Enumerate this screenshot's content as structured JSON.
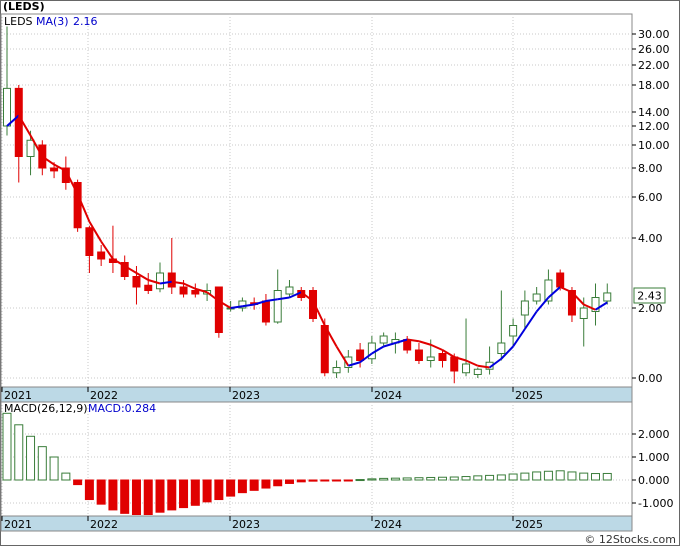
{
  "header": {
    "symbol_title": "(LEDS)",
    "ticker": "LEDS",
    "ma_label": "MA(3)",
    "ma_value": "2.16",
    "macd_label": "MACD(26,12,9)",
    "macd_value_label": "MACD:0.284",
    "last_price_badge": "2.43",
    "copyright": "© 12Stocks.com"
  },
  "colors": {
    "up_candle": "#3a7d3a",
    "down_candle": "#e00000",
    "ma_down": "#e00000",
    "ma_up": "#0000dd",
    "axis_band": "#bcd9e6",
    "grid": "#c8c8c8",
    "macd_pos": "#3a7d3a",
    "macd_neg": "#e00000"
  },
  "chart_data": [
    {
      "type": "candlestick",
      "title": "(LEDS)",
      "y_scale": "log",
      "y_ticks": [
        0.0,
        2.0,
        4.0,
        6.0,
        8.0,
        10.0,
        12.0,
        14.0,
        18.0,
        22.0,
        26.0,
        30.0
      ],
      "y_tick_labels": [
        "0.00",
        "2.00",
        "4.00",
        "6.00",
        "8.00",
        "10.00",
        "12.00",
        "14.00",
        "18.00",
        "22.00",
        "26.00",
        "30.00"
      ],
      "x_labels": [
        "2021",
        "2022",
        "2023",
        "2024",
        "2025"
      ],
      "grid": true,
      "candles": [
        {
          "o": 12.0,
          "h": 32.0,
          "l": 11.0,
          "c": 17.5
        },
        {
          "o": 17.5,
          "h": 18.0,
          "l": 7.0,
          "c": 9.0
        },
        {
          "o": 9.0,
          "h": 11.5,
          "l": 7.5,
          "c": 10.5
        },
        {
          "o": 10.0,
          "h": 10.5,
          "l": 7.5,
          "c": 8.0
        },
        {
          "o": 8.0,
          "h": 8.5,
          "l": 7.3,
          "c": 7.8
        },
        {
          "o": 8.0,
          "h": 9.0,
          "l": 6.5,
          "c": 7.0
        },
        {
          "o": 7.0,
          "h": 7.2,
          "l": 4.3,
          "c": 4.5
        },
        {
          "o": 4.5,
          "h": 4.6,
          "l": 3.0,
          "c": 3.5
        },
        {
          "o": 3.6,
          "h": 3.8,
          "l": 3.2,
          "c": 3.4
        },
        {
          "o": 3.4,
          "h": 4.6,
          "l": 3.0,
          "c": 3.3
        },
        {
          "o": 3.3,
          "h": 3.5,
          "l": 2.8,
          "c": 2.9
        },
        {
          "o": 2.9,
          "h": 3.2,
          "l": 2.1,
          "c": 2.6
        },
        {
          "o": 2.65,
          "h": 3.0,
          "l": 2.4,
          "c": 2.5
        },
        {
          "o": 2.55,
          "h": 3.3,
          "l": 2.45,
          "c": 3.0
        },
        {
          "o": 3.0,
          "h": 4.0,
          "l": 2.4,
          "c": 2.6
        },
        {
          "o": 2.6,
          "h": 2.8,
          "l": 2.3,
          "c": 2.4
        },
        {
          "o": 2.5,
          "h": 2.7,
          "l": 2.3,
          "c": 2.4
        },
        {
          "o": 2.4,
          "h": 2.7,
          "l": 2.2,
          "c": 2.5
        },
        {
          "o": 2.6,
          "h": 2.6,
          "l": 1.15,
          "c": 1.3
        },
        {
          "o": 2.0,
          "h": 2.2,
          "l": 1.9,
          "c": 2.0
        },
        {
          "o": 2.0,
          "h": 2.3,
          "l": 1.9,
          "c": 2.2
        },
        {
          "o": 2.15,
          "h": 2.3,
          "l": 1.95,
          "c": 2.1
        },
        {
          "o": 2.2,
          "h": 2.4,
          "l": 1.5,
          "c": 1.6
        },
        {
          "o": 1.6,
          "h": 3.1,
          "l": 1.55,
          "c": 2.5
        },
        {
          "o": 2.4,
          "h": 2.8,
          "l": 2.3,
          "c": 2.6
        },
        {
          "o": 2.5,
          "h": 2.6,
          "l": 2.2,
          "c": 2.3
        },
        {
          "o": 2.5,
          "h": 2.6,
          "l": 1.6,
          "c": 1.7
        },
        {
          "o": 1.5,
          "h": 1.7,
          "l": 0.05,
          "c": 0.15
        },
        {
          "o": 0.15,
          "h": 0.5,
          "l": 0.0,
          "c": 0.3
        },
        {
          "o": 0.3,
          "h": 0.8,
          "l": 0.15,
          "c": 0.6
        },
        {
          "o": 0.8,
          "h": 1.0,
          "l": 0.3,
          "c": 0.5
        },
        {
          "o": 0.55,
          "h": 1.2,
          "l": 0.4,
          "c": 1.0
        },
        {
          "o": 1.0,
          "h": 1.3,
          "l": 0.9,
          "c": 1.2
        },
        {
          "o": 1.0,
          "h": 1.3,
          "l": 0.7,
          "c": 1.1
        },
        {
          "o": 1.1,
          "h": 1.2,
          "l": 0.7,
          "c": 0.8
        },
        {
          "o": 0.8,
          "h": 1.0,
          "l": 0.4,
          "c": 0.5
        },
        {
          "o": 0.5,
          "h": 1.1,
          "l": 0.3,
          "c": 0.6
        },
        {
          "o": 0.7,
          "h": 0.8,
          "l": 0.3,
          "c": 0.5
        },
        {
          "o": 0.6,
          "h": 0.7,
          "l": -0.15,
          "c": 0.2
        },
        {
          "o": 0.15,
          "h": 1.7,
          "l": 0.05,
          "c": 0.4
        },
        {
          "o": 0.1,
          "h": 0.3,
          "l": 0.0,
          "c": 0.25
        },
        {
          "o": 0.25,
          "h": 0.9,
          "l": 0.1,
          "c": 0.45
        },
        {
          "o": 0.7,
          "h": 2.5,
          "l": 0.5,
          "c": 1.0
        },
        {
          "o": 1.2,
          "h": 1.7,
          "l": 0.9,
          "c": 1.5
        },
        {
          "o": 1.8,
          "h": 2.5,
          "l": 1.4,
          "c": 2.2
        },
        {
          "o": 2.2,
          "h": 2.6,
          "l": 2.1,
          "c": 2.4
        },
        {
          "o": 2.2,
          "h": 3.1,
          "l": 2.1,
          "c": 2.8
        },
        {
          "o": 3.0,
          "h": 3.1,
          "l": 2.5,
          "c": 2.6
        },
        {
          "o": 2.5,
          "h": 2.6,
          "l": 1.6,
          "c": 1.8
        },
        {
          "o": 1.7,
          "h": 2.3,
          "l": 0.9,
          "c": 2.0
        },
        {
          "o": 1.9,
          "h": 2.7,
          "l": 1.5,
          "c": 2.3
        },
        {
          "o": 2.2,
          "h": 2.7,
          "l": 2.1,
          "c": 2.43
        }
      ],
      "ma": [
        12.0,
        13.5,
        11.0,
        9.0,
        8.3,
        7.8,
        6.2,
        4.8,
        3.9,
        3.4,
        3.2,
        3.0,
        2.8,
        2.7,
        2.75,
        2.7,
        2.55,
        2.45,
        2.2,
        2.0,
        2.05,
        2.1,
        2.2,
        2.25,
        2.3,
        2.45,
        2.2,
        1.5,
        0.9,
        0.35,
        0.45,
        0.7,
        0.9,
        1.0,
        1.1,
        1.05,
        0.95,
        0.8,
        0.6,
        0.5,
        0.35,
        0.3,
        0.55,
        0.9,
        1.4,
        1.9,
        2.3,
        2.6,
        2.45,
        2.1,
        1.95,
        2.16
      ],
      "last_value": 2.43
    },
    {
      "type": "bar",
      "title": "MACD(26,12,9)",
      "y_ticks": [
        2.0,
        1.0,
        0.0,
        -1.0
      ],
      "y_tick_labels": [
        "2.000",
        "1.000",
        "0.000",
        "-1.000"
      ],
      "y_range": [
        -1.55,
        3.4
      ],
      "x_labels": [
        "2021",
        "2022",
        "2023",
        "2024",
        "2025"
      ],
      "values": [
        2.9,
        2.4,
        1.9,
        1.45,
        1.0,
        0.3,
        -0.2,
        -0.85,
        -1.05,
        -1.3,
        -1.45,
        -1.5,
        -1.5,
        -1.4,
        -1.3,
        -1.2,
        -1.1,
        -0.95,
        -0.85,
        -0.7,
        -0.55,
        -0.45,
        -0.35,
        -0.25,
        -0.15,
        -0.08,
        -0.05,
        -0.02,
        -0.01,
        -0.02,
        0.02,
        0.05,
        0.07,
        0.08,
        0.09,
        0.1,
        0.11,
        0.12,
        0.13,
        0.15,
        0.18,
        0.2,
        0.22,
        0.26,
        0.3,
        0.35,
        0.38,
        0.4,
        0.35,
        0.3,
        0.28,
        0.284
      ],
      "current_value": 0.284
    }
  ]
}
